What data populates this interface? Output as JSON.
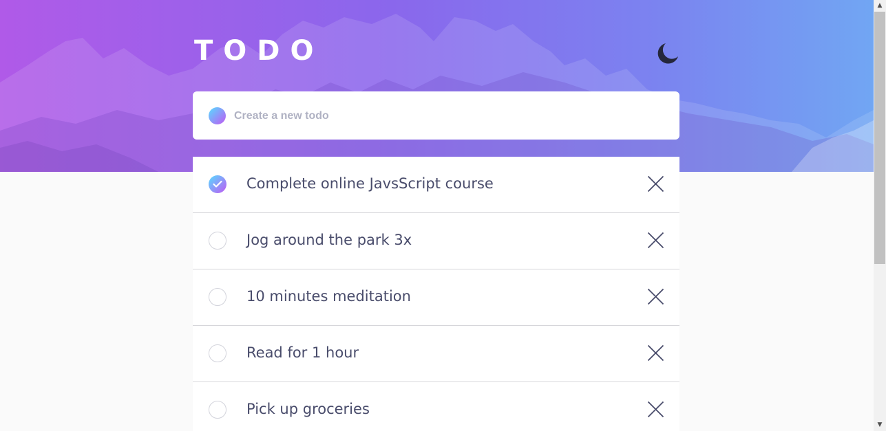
{
  "app": {
    "title": "TODO",
    "theme_toggle_icon": "moon-icon"
  },
  "new_todo": {
    "placeholder": "Create a new todo",
    "value": ""
  },
  "todos": [
    {
      "text": "Complete online JavsScript course",
      "completed": true
    },
    {
      "text": "Jog around the park 3x",
      "completed": false
    },
    {
      "text": "10 minutes meditation",
      "completed": false
    },
    {
      "text": "Read for 1 hour",
      "completed": false
    },
    {
      "text": "Pick up groceries",
      "completed": false
    }
  ],
  "icons": {
    "check": "check-icon",
    "remove": "cross-icon",
    "scroll_up": "▲",
    "scroll_down": "▼"
  },
  "colors": {
    "gradient_start": "#57ddff",
    "gradient_end": "#c058f3",
    "text": "#494c6b",
    "placeholder": "#b0b2c3",
    "background": "#fafafa"
  }
}
